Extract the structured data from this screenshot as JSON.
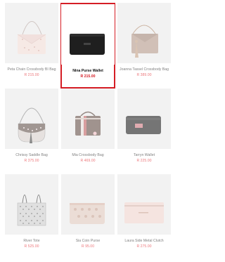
{
  "products": [
    {
      "title": "Peta Chain Crossbody BI Bag",
      "price": "R 215.00",
      "icon": "crossbody-bag-icon"
    },
    {
      "title": "Nina Purse Wallet",
      "price": "R 215.00",
      "icon": "purse-wallet-icon",
      "selected": true
    },
    {
      "title": "Joanna Tassel Crossbody Bag",
      "price": "R 389.00",
      "icon": "tassel-bag-icon"
    },
    {
      "title": "Chrissy Saddle Bag",
      "price": "R 375.00",
      "icon": "saddle-bag-icon"
    },
    {
      "title": "Mia Crossbody Bag",
      "price": "R 469.00",
      "icon": "crossbody-bag-icon"
    },
    {
      "title": "Tarryn Wallet",
      "price": "R 225.00",
      "icon": "wallet-icon"
    },
    {
      "title": "River Tote",
      "price": "R 525.00",
      "icon": "tote-bag-icon"
    },
    {
      "title": "Sia Coin Purse",
      "price": "R 95.00",
      "icon": "coin-purse-icon"
    },
    {
      "title": "Laura Side Metal Clutch",
      "price": "R 275.00",
      "icon": "clutch-icon"
    }
  ],
  "colors": {
    "selected_border": "#d51d25",
    "price": "#e64d52",
    "tile_bg": "#ececec"
  }
}
